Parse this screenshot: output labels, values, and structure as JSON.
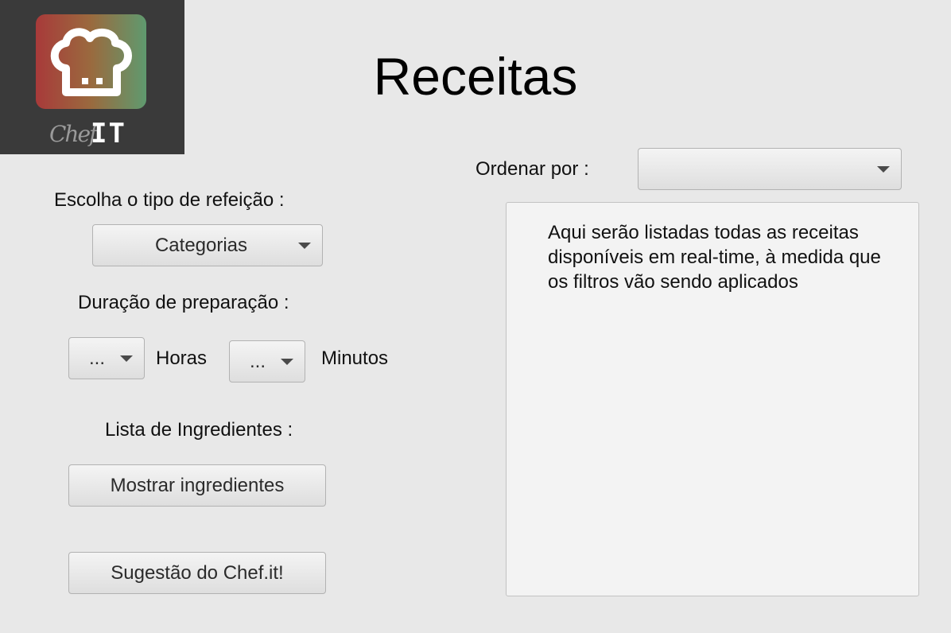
{
  "logo": {
    "script_text": "Chef",
    "mark_text": "IT"
  },
  "title": "Receitas",
  "sort": {
    "label": "Ordenar por :",
    "value": ""
  },
  "meal_type": {
    "label": "Escolha o tipo de refeição :",
    "value": "Categorias"
  },
  "duration": {
    "label": "Duração de preparação :",
    "hours_value": "...",
    "hours_label": "Horas",
    "minutes_value": "...",
    "minutes_label": "Minutos"
  },
  "ingredients": {
    "label": "Lista de Ingredientes :",
    "button": "Mostrar ingredientes"
  },
  "suggestion_button": "Sugestão do Chef.it!",
  "recipe_list": {
    "placeholder": "Aqui serão listadas todas as receitas disponíveis em real-time, à medida que os filtros vão sendo aplicados"
  },
  "colors": {
    "background": "#e8e8e8",
    "logo_background": "#3a3a3a",
    "logo_gradient_start": "#a83a3a",
    "logo_gradient_end": "#5f9a6f"
  },
  "icons": [
    "chef-hat-icon",
    "chevron-down-icon"
  ]
}
